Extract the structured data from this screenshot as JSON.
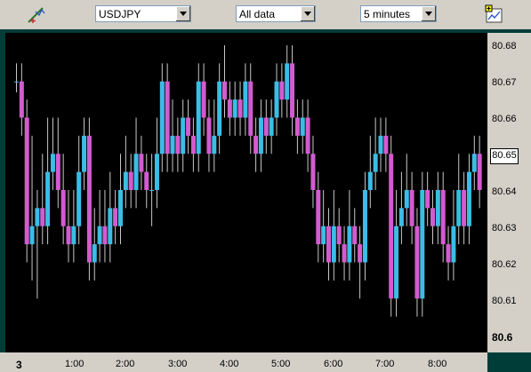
{
  "toolbar": {
    "icons": {
      "tool": "crosshair-pencil-icon",
      "chart": "line-chart-icon"
    },
    "symbol": "USDJPY",
    "range": "All data",
    "interval": "5 minutes"
  },
  "colors": {
    "up": "#3bbde4",
    "down": "#d35bd0",
    "wick": "#c8c8c8",
    "background": "#000000",
    "frame": "#003c38"
  },
  "y_axis": {
    "labels": [
      "80.68",
      "80.67",
      "80.66",
      "80.65",
      "80.64",
      "80.63",
      "80.62",
      "80.61",
      "80.6"
    ],
    "current_value": "80.65"
  },
  "x_axis": {
    "labels": [
      "3",
      "1:00",
      "2:00",
      "3:00",
      "4:00",
      "5:00",
      "6:00",
      "7:00",
      "8:00"
    ]
  },
  "chart_data": {
    "type": "candlestick",
    "symbol": "USDJPY",
    "interval": "5 minutes",
    "ylim": [
      80.6,
      80.685
    ],
    "candles": [
      [
        80.67,
        80.67,
        80.675,
        80.667
      ],
      [
        80.67,
        80.66,
        80.675,
        80.655
      ],
      [
        80.66,
        80.625,
        80.665,
        80.62
      ],
      [
        80.625,
        80.63,
        80.655,
        80.615
      ],
      [
        80.63,
        80.635,
        80.64,
        80.61
      ],
      [
        80.635,
        80.63,
        80.65,
        80.625
      ],
      [
        80.63,
        80.645,
        80.66,
        80.625
      ],
      [
        80.645,
        80.65,
        80.66,
        80.64
      ],
      [
        80.65,
        80.64,
        80.66,
        80.635
      ],
      [
        80.64,
        80.63,
        80.65,
        80.625
      ],
      [
        80.63,
        80.625,
        80.64,
        80.62
      ],
      [
        80.625,
        80.63,
        80.64,
        80.62
      ],
      [
        80.63,
        80.645,
        80.655,
        80.625
      ],
      [
        80.645,
        80.655,
        80.66,
        80.64
      ],
      [
        80.655,
        80.62,
        80.66,
        80.615
      ],
      [
        80.62,
        80.625,
        80.635,
        80.615
      ],
      [
        80.625,
        80.63,
        80.64,
        80.62
      ],
      [
        80.63,
        80.625,
        80.64,
        80.62
      ],
      [
        80.625,
        80.635,
        80.645,
        80.62
      ],
      [
        80.635,
        80.63,
        80.64,
        80.625
      ],
      [
        80.63,
        80.64,
        80.65,
        80.625
      ],
      [
        80.64,
        80.645,
        80.655,
        80.635
      ],
      [
        80.645,
        80.64,
        80.65,
        80.635
      ],
      [
        80.64,
        80.65,
        80.66,
        80.635
      ],
      [
        80.65,
        80.645,
        80.655,
        80.64
      ],
      [
        80.645,
        80.64,
        80.65,
        80.635
      ],
      [
        80.64,
        80.64,
        80.65,
        80.63
      ],
      [
        80.64,
        80.65,
        80.66,
        80.635
      ],
      [
        80.65,
        80.67,
        80.675,
        80.645
      ],
      [
        80.67,
        80.65,
        80.675,
        80.645
      ],
      [
        80.65,
        80.655,
        80.665,
        80.645
      ],
      [
        80.655,
        80.65,
        80.66,
        80.645
      ],
      [
        80.65,
        80.66,
        80.665,
        80.645
      ],
      [
        80.66,
        80.655,
        80.665,
        80.65
      ],
      [
        80.655,
        80.65,
        80.66,
        80.645
      ],
      [
        80.65,
        80.67,
        80.675,
        80.645
      ],
      [
        80.67,
        80.66,
        80.675,
        80.655
      ],
      [
        80.66,
        80.65,
        80.665,
        80.645
      ],
      [
        80.65,
        80.655,
        80.665,
        80.645
      ],
      [
        80.655,
        80.67,
        80.675,
        80.65
      ],
      [
        80.67,
        80.665,
        80.68,
        80.66
      ],
      [
        80.665,
        80.66,
        80.67,
        80.655
      ],
      [
        80.66,
        80.665,
        80.67,
        80.655
      ],
      [
        80.665,
        80.66,
        80.67,
        80.655
      ],
      [
        80.66,
        80.67,
        80.675,
        80.655
      ],
      [
        80.67,
        80.655,
        80.675,
        80.65
      ],
      [
        80.655,
        80.65,
        80.66,
        80.645
      ],
      [
        80.65,
        80.66,
        80.665,
        80.645
      ],
      [
        80.66,
        80.655,
        80.665,
        80.65
      ],
      [
        80.655,
        80.66,
        80.665,
        80.65
      ],
      [
        80.66,
        80.67,
        80.675,
        80.655
      ],
      [
        80.67,
        80.665,
        80.675,
        80.66
      ],
      [
        80.665,
        80.675,
        80.68,
        80.66
      ],
      [
        80.675,
        80.66,
        80.68,
        80.655
      ],
      [
        80.66,
        80.655,
        80.665,
        80.65
      ],
      [
        80.655,
        80.66,
        80.665,
        80.65
      ],
      [
        80.66,
        80.65,
        80.665,
        80.645
      ],
      [
        80.65,
        80.64,
        80.655,
        80.635
      ],
      [
        80.64,
        80.625,
        80.645,
        80.62
      ],
      [
        80.625,
        80.63,
        80.64,
        80.62
      ],
      [
        80.63,
        80.62,
        80.635,
        80.615
      ],
      [
        80.62,
        80.63,
        80.64,
        80.615
      ],
      [
        80.63,
        80.625,
        80.635,
        80.62
      ],
      [
        80.625,
        80.62,
        80.63,
        80.615
      ],
      [
        80.62,
        80.63,
        80.64,
        80.615
      ],
      [
        80.63,
        80.625,
        80.635,
        80.62
      ],
      [
        80.625,
        80.62,
        80.63,
        80.61
      ],
      [
        80.62,
        80.64,
        80.645,
        80.615
      ],
      [
        80.64,
        80.645,
        80.655,
        80.635
      ],
      [
        80.645,
        80.65,
        80.66,
        80.64
      ],
      [
        80.65,
        80.655,
        80.66,
        80.645
      ],
      [
        80.655,
        80.65,
        80.66,
        80.645
      ],
      [
        80.65,
        80.61,
        80.655,
        80.605
      ],
      [
        80.61,
        80.63,
        80.64,
        80.605
      ],
      [
        80.63,
        80.635,
        80.645,
        80.625
      ],
      [
        80.635,
        80.64,
        80.65,
        80.63
      ],
      [
        80.64,
        80.63,
        80.645,
        80.625
      ],
      [
        80.63,
        80.61,
        80.635,
        80.605
      ],
      [
        80.61,
        80.64,
        80.645,
        80.605
      ],
      [
        80.64,
        80.635,
        80.645,
        80.63
      ],
      [
        80.635,
        80.63,
        80.64,
        80.625
      ],
      [
        80.63,
        80.64,
        80.645,
        80.625
      ],
      [
        80.64,
        80.625,
        80.645,
        80.62
      ],
      [
        80.625,
        80.62,
        80.63,
        80.615
      ],
      [
        80.62,
        80.63,
        80.64,
        80.615
      ],
      [
        80.63,
        80.64,
        80.65,
        80.625
      ],
      [
        80.64,
        80.63,
        80.645,
        80.625
      ],
      [
        80.63,
        80.645,
        80.65,
        80.625
      ],
      [
        80.645,
        80.65,
        80.655,
        80.64
      ],
      [
        80.65,
        80.64,
        80.655,
        80.635
      ]
    ]
  }
}
